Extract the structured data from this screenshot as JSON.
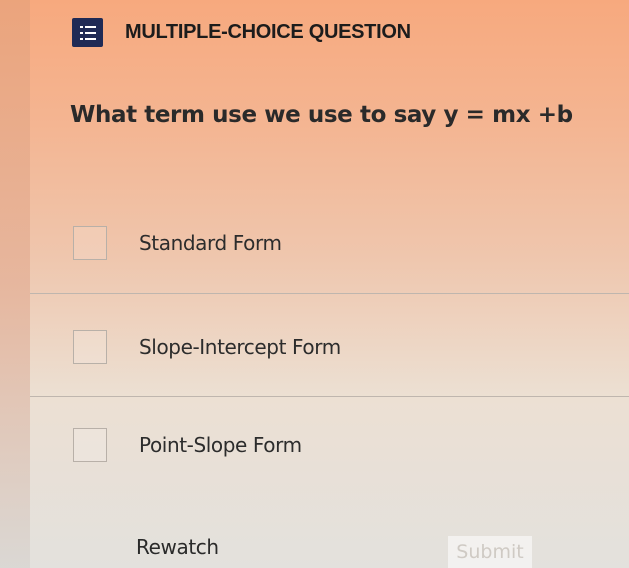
{
  "header": {
    "title": "MULTIPLE-CHOICE QUESTION",
    "icon": "question-list-icon"
  },
  "question": {
    "text": "What term use we use to say y = mx +b"
  },
  "options": [
    {
      "label": "Standard Form",
      "checked": false
    },
    {
      "label": "Slope-Intercept Form",
      "checked": false
    },
    {
      "label": "Point-Slope Form",
      "checked": false
    }
  ],
  "actions": {
    "rewatch_label": "Rewatch",
    "submit_label": "Submit",
    "submit_enabled": false
  },
  "colors": {
    "header_icon_bg": "#1f2a55",
    "background_top": "#f7a97e",
    "background_bottom": "#e3e1dd"
  }
}
